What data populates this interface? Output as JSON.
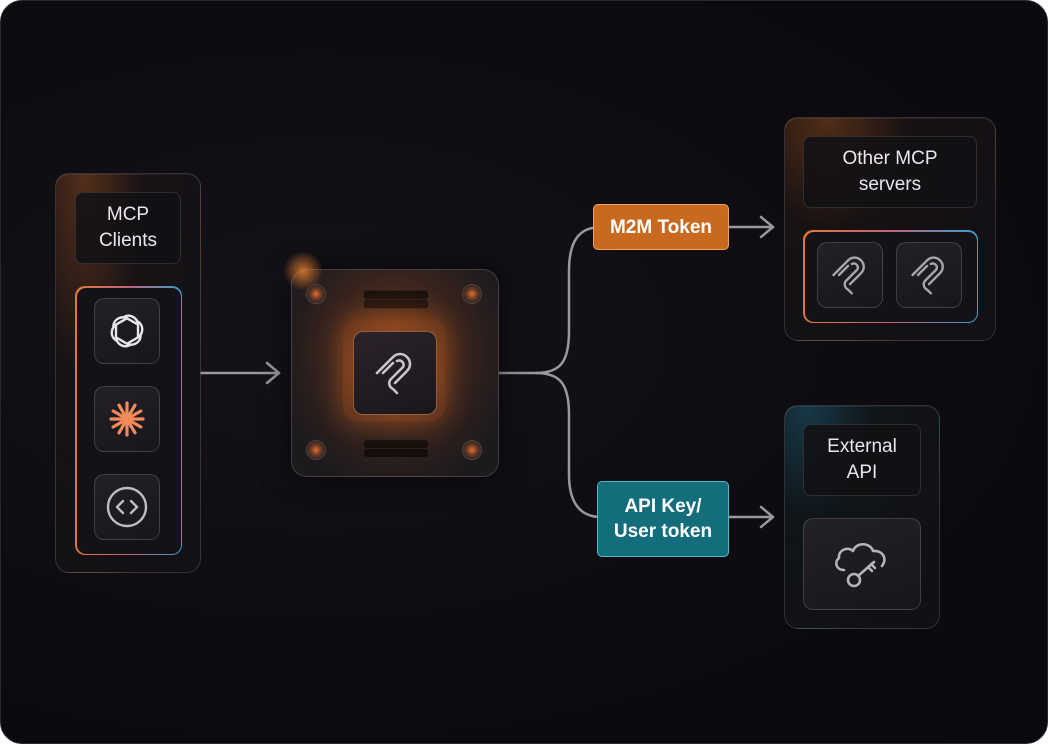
{
  "clients": {
    "title": "MCP\nClients",
    "icons": [
      "openai-icon",
      "claude-icon",
      "code-icon"
    ]
  },
  "hub": {
    "icon": "mcp-logo-icon"
  },
  "tokens": {
    "m2m": "M2M Token",
    "api": "API Key/\nUser token"
  },
  "other_servers": {
    "title": "Other MCP\nservers",
    "icons": [
      "mcp-logo-icon",
      "mcp-logo-icon"
    ]
  },
  "external_api": {
    "title": "External\nAPI",
    "icon": "cloud-key-icon"
  },
  "colors": {
    "accent_orange": "#c8691f",
    "accent_teal": "#136d7a",
    "background": "#0d0b10"
  }
}
